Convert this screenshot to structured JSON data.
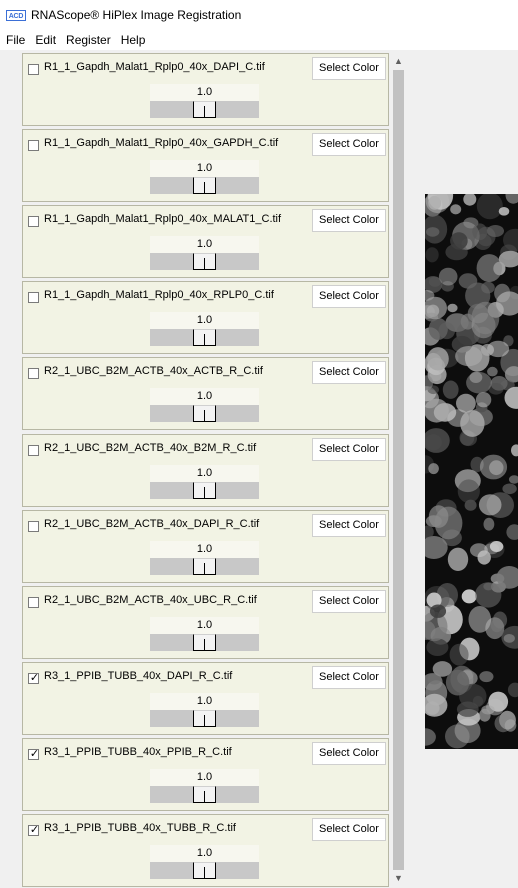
{
  "window": {
    "title": "RNAScope® HiPlex Image Registration",
    "icon_text": "ACD"
  },
  "menu": [
    "File",
    "Edit",
    "Register",
    "Help"
  ],
  "select_color_label": "Select Color",
  "channels": [
    {
      "filename": "R1_1_Gapdh_Malat1_Rplp0_40x_DAPI_C.tif",
      "checked": false,
      "value": "1.0",
      "slider_fraction": 0.5
    },
    {
      "filename": "R1_1_Gapdh_Malat1_Rplp0_40x_GAPDH_C.tif",
      "checked": false,
      "value": "1.0",
      "slider_fraction": 0.5
    },
    {
      "filename": "R1_1_Gapdh_Malat1_Rplp0_40x_MALAT1_C.tif",
      "checked": false,
      "value": "1.0",
      "slider_fraction": 0.5
    },
    {
      "filename": "R1_1_Gapdh_Malat1_Rplp0_40x_RPLP0_C.tif",
      "checked": false,
      "value": "1.0",
      "slider_fraction": 0.5
    },
    {
      "filename": "R2_1_UBC_B2M_ACTB_40x_ACTB_R_C.tif",
      "checked": false,
      "value": "1.0",
      "slider_fraction": 0.5
    },
    {
      "filename": "R2_1_UBC_B2M_ACTB_40x_B2M_R_C.tif",
      "checked": false,
      "value": "1.0",
      "slider_fraction": 0.5
    },
    {
      "filename": "R2_1_UBC_B2M_ACTB_40x_DAPI_R_C.tif",
      "checked": false,
      "value": "1.0",
      "slider_fraction": 0.5
    },
    {
      "filename": "R2_1_UBC_B2M_ACTB_40x_UBC_R_C.tif",
      "checked": false,
      "value": "1.0",
      "slider_fraction": 0.5
    },
    {
      "filename": "R3_1_PPIB_TUBB_40x_DAPI_R_C.tif",
      "checked": true,
      "value": "1.0",
      "slider_fraction": 0.5
    },
    {
      "filename": "R3_1_PPIB_TUBB_40x_PPIB_R_C.tif",
      "checked": true,
      "value": "1.0",
      "slider_fraction": 0.5
    },
    {
      "filename": "R3_1_PPIB_TUBB_40x_TUBB_R_C.tif",
      "checked": true,
      "value": "1.0",
      "slider_fraction": 0.5
    }
  ],
  "scroll": {
    "up_icon": "scroll-up-icon",
    "down_icon": "scroll-down-icon"
  },
  "colors": {
    "panel_bg": "#f2f3e4",
    "accent": "#3b6fd6"
  }
}
